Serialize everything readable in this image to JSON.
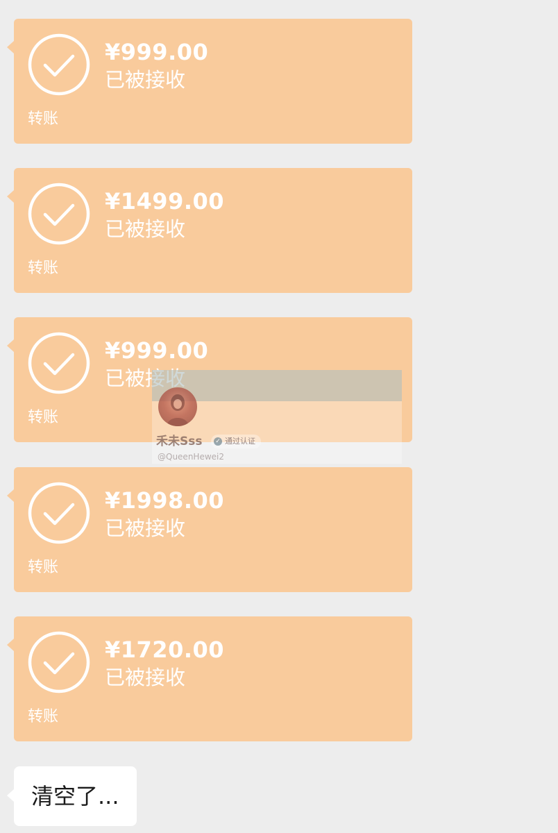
{
  "chat": {
    "transfers": [
      {
        "amount": "¥999.00",
        "status": "已被接收",
        "type": "转账",
        "icon": "check-circle-icon"
      },
      {
        "amount": "¥1499.00",
        "status": "已被接收",
        "type": "转账",
        "icon": "check-circle-icon"
      },
      {
        "amount": "¥999.00",
        "status": "已被接收",
        "type": "转账",
        "icon": "check-circle-icon"
      },
      {
        "amount": "¥1998.00",
        "status": "已被接收",
        "type": "转账",
        "icon": "check-circle-icon"
      },
      {
        "amount": "¥1720.00",
        "status": "已被接收",
        "type": "转账",
        "icon": "check-circle-icon"
      }
    ],
    "message": {
      "text": "清空了..."
    }
  },
  "watermark": {
    "name": "禾未Sss",
    "badge": "通过认证",
    "handle": "@QueenHewei2"
  },
  "colors": {
    "background": "#ededed",
    "transfer_card": "#f9cb9c",
    "bubble": "#ffffff"
  }
}
